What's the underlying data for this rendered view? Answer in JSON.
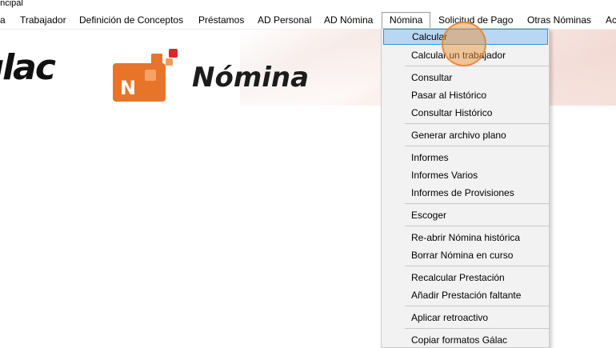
{
  "window": {
    "title": "rincipal"
  },
  "menubar": {
    "items": [
      {
        "label": "a"
      },
      {
        "label": "Trabajador"
      },
      {
        "label": "Definición de Conceptos"
      },
      {
        "label": "Préstamos"
      },
      {
        "label": "AD Personal"
      },
      {
        "label": "AD Nómina"
      },
      {
        "label": "Nómina",
        "active": true
      },
      {
        "label": "Solicitud de Pago"
      },
      {
        "label": "Otras Nóminas"
      },
      {
        "label": "Ac"
      }
    ]
  },
  "banner": {
    "brand_text": "ılac",
    "product_name": "Nómina",
    "icon_letter": "N",
    "colors": {
      "orange": "#e8742a",
      "red": "#d42a2a"
    }
  },
  "dropdown": {
    "items": [
      {
        "label": "Calcular",
        "highlighted": true
      },
      {
        "label": "Calcular un trabajador"
      },
      {
        "label": "Consultar"
      },
      {
        "label": "Pasar al Histórico"
      },
      {
        "label": "Consultar Histórico"
      },
      {
        "label": "Generar archivo plano"
      },
      {
        "label": "Informes"
      },
      {
        "label": "Informes Varios"
      },
      {
        "label": "Informes de Provisiones"
      },
      {
        "label": "Escoger"
      },
      {
        "label": "Re-abrir Nómina histórica"
      },
      {
        "label": "Borrar Nómina en curso"
      },
      {
        "label": "Recalcular Prestación"
      },
      {
        "label": "Añadir Prestación faltante"
      },
      {
        "label": "Aplicar retroactivo"
      },
      {
        "label": "Copiar formatos Gálac"
      }
    ],
    "highlight_color": "#b8d7f4"
  }
}
